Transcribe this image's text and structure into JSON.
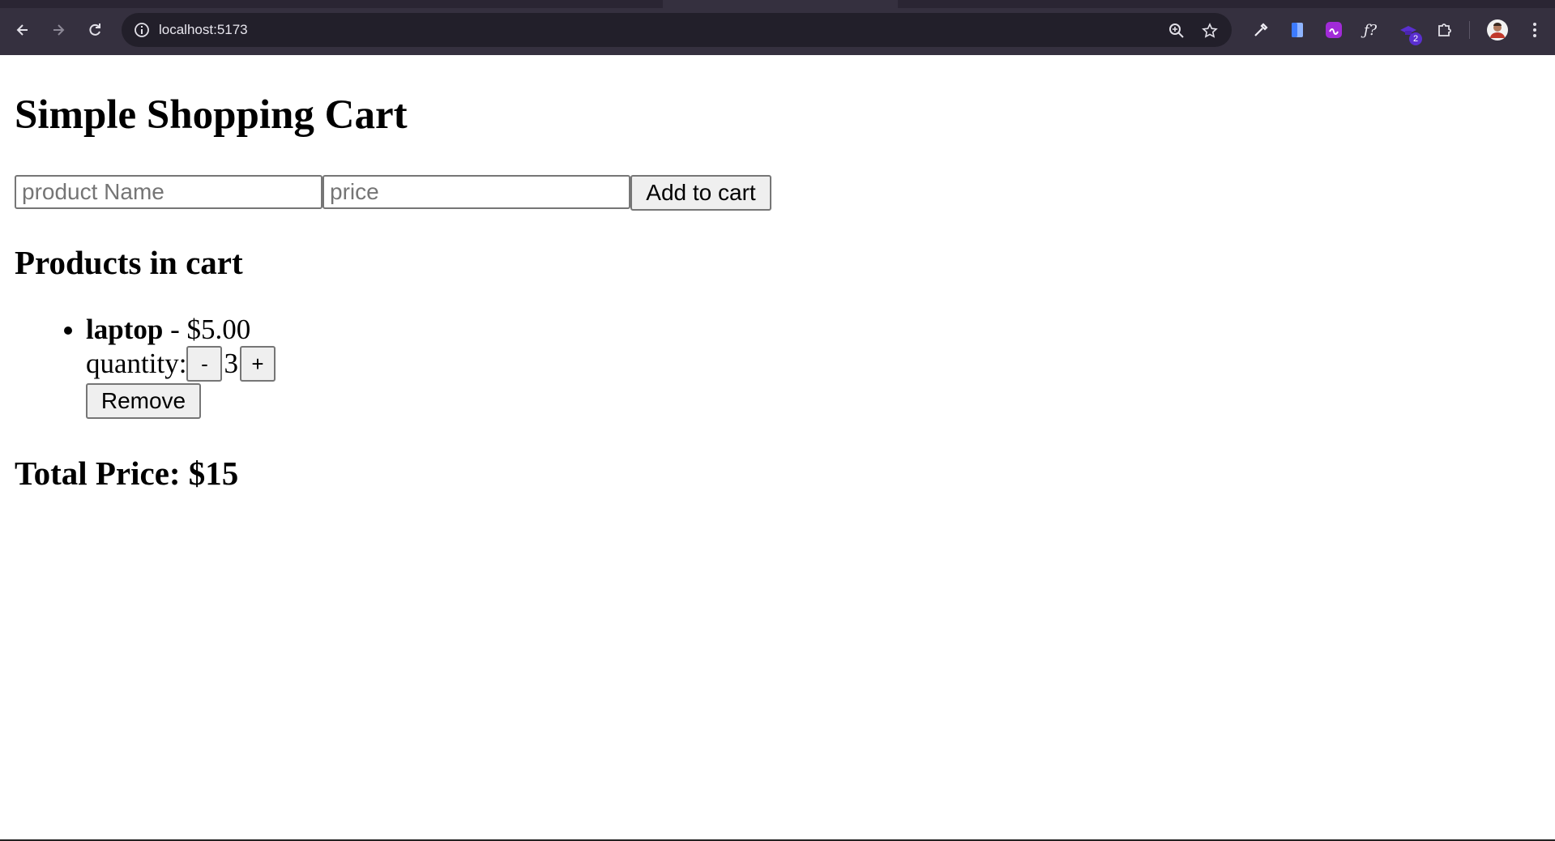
{
  "browser": {
    "url": "localhost:5173",
    "extension_badge": "2",
    "icons": [
      "back-icon",
      "forward-icon",
      "reload-icon",
      "site-info-icon",
      "zoom-icon",
      "bookmark-star-icon",
      "eyedropper-icon",
      "docs-icon",
      "extension-purple-icon",
      "fx-icon",
      "extension-hat-icon",
      "puzzle-icon",
      "avatar",
      "kebab-menu-icon"
    ]
  },
  "page": {
    "title": "Simple Shopping Cart",
    "form": {
      "name_placeholder": "product Name",
      "price_placeholder": "price",
      "add_label": "Add to cart"
    },
    "cart_heading": "Products in cart",
    "items": [
      {
        "name": "laptop",
        "separator": " - ",
        "price": "$5.00",
        "quantity_label": "quantity:",
        "decrement_label": "-",
        "quantity": "3",
        "increment_label": "+",
        "remove_label": "Remove"
      }
    ],
    "total": "Total Price: $15"
  }
}
